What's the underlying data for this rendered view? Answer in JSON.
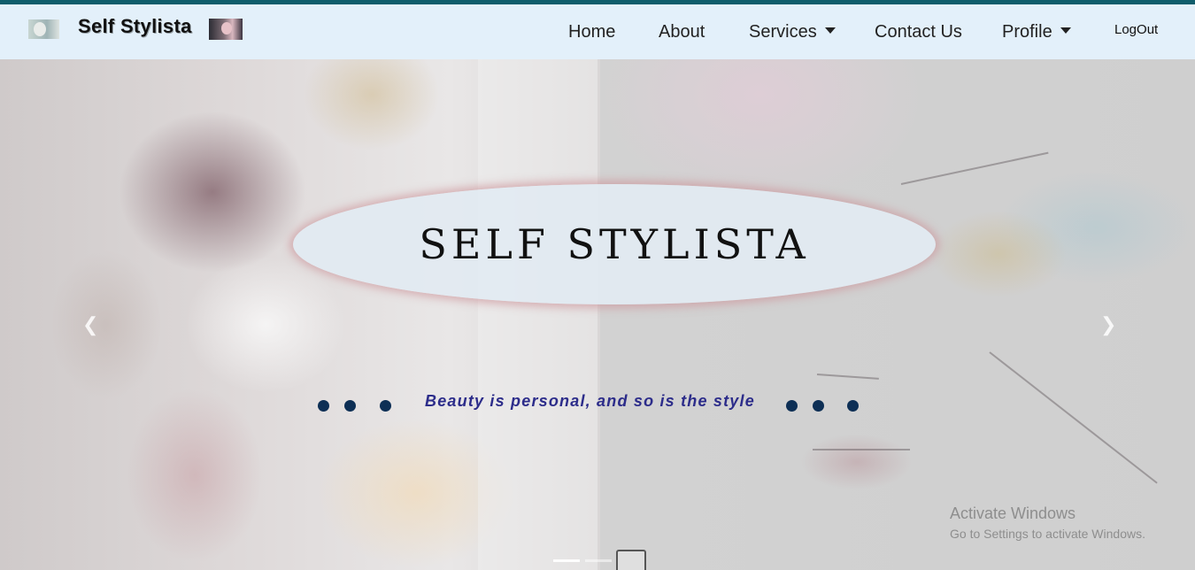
{
  "navbar": {
    "brand": "Self Stylista",
    "items": [
      "Home",
      "About",
      "Services",
      "Contact Us",
      "Profile"
    ],
    "logout": "LogOut",
    "accent_color": "#0f5d6b",
    "background_color": "#e3f0fa"
  },
  "hero": {
    "title": "SELF STYLISTA",
    "tagline": "Beauty is personal, and so is the style",
    "prev_icon": "chevron-left-icon",
    "next_icon": "chevron-right-icon",
    "slide_count": 3,
    "active_slide": 3
  },
  "watermark": {
    "title": "Activate Windows",
    "subtitle": "Go to Settings to activate Windows."
  }
}
